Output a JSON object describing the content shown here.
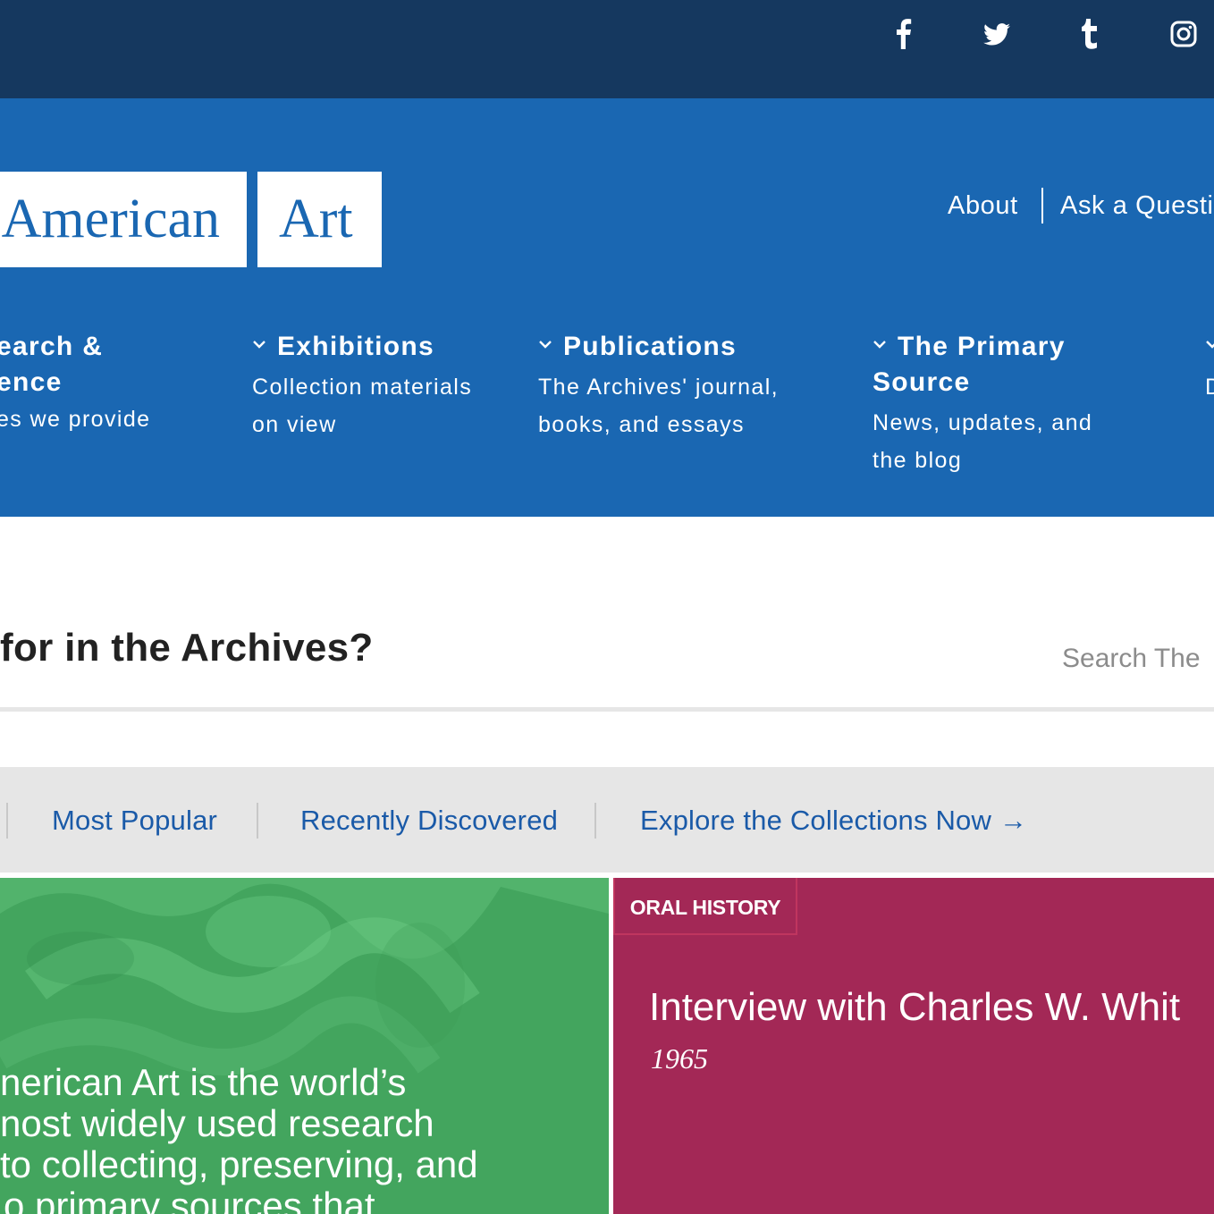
{
  "social": {
    "icons": [
      "facebook-icon",
      "twitter-icon",
      "tumblr-icon",
      "instagram-icon"
    ]
  },
  "logo": {
    "part1": "American",
    "part2": "Art"
  },
  "utility_nav": {
    "about": "About",
    "ask": "Ask a Questi"
  },
  "main_nav": [
    {
      "title_line1": "earch &",
      "title_line2": "ence",
      "desc_line1": "es we provide",
      "desc_line2": ""
    },
    {
      "title_line1": "Exhibitions",
      "title_line2": "",
      "desc_line1": "Collection materials",
      "desc_line2": "on view"
    },
    {
      "title_line1": "Publications",
      "title_line2": "",
      "desc_line1": "The Archives' journal,",
      "desc_line2": "books, and essays"
    },
    {
      "title_line1": "The Primary",
      "title_line2": "Source",
      "desc_line1": "News, updates, and",
      "desc_line2": "the blog"
    },
    {
      "title_line1": "",
      "title_line2": "",
      "desc_line1": "D",
      "desc_line2": ""
    }
  ],
  "search": {
    "question": "for in the Archives?",
    "placeholder": "Search The"
  },
  "links_strip": {
    "most_popular": "Most Popular",
    "recently_discovered": "Recently Discovered",
    "explore": "Explore the Collections Now →"
  },
  "tiles": {
    "green": {
      "lines": [
        "nerican Art is the world’s",
        "nost widely used research",
        "to collecting, preserving, and",
        "o primary sources that"
      ]
    },
    "magenta": {
      "tag": "ORAL HISTORY",
      "title": "Interview with Charles W. Whit",
      "date": "1965"
    }
  },
  "colors": {
    "social_bar": "#15385f",
    "header_blue": "#1a67b2",
    "link_blue": "#1a5aa8",
    "strip_gray": "#e6e6e6",
    "tile_green": "#43a55e",
    "tile_magenta": "#a32856"
  }
}
